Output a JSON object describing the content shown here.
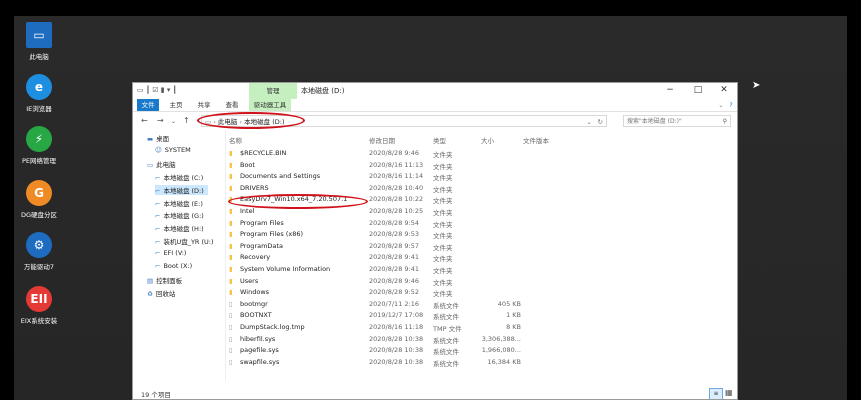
{
  "desktop": {
    "icons": [
      {
        "label": "此电脑",
        "icon": "computer-icon",
        "color": "#e8e8e8"
      },
      {
        "label": "IE浏览器",
        "icon": "ie-icon",
        "color": "#1e8fe0"
      },
      {
        "label": "PE网络管理",
        "icon": "network-icon",
        "color": "#28a745"
      },
      {
        "label": "DG硬盘分区",
        "icon": "diskgenius-icon",
        "color": "#f08a24"
      },
      {
        "label": "万能驱动7",
        "icon": "gear-icon",
        "color": "#1e6cbf"
      },
      {
        "label": "EIX系统安装",
        "icon": "eix-icon",
        "color": "#e53935"
      }
    ]
  },
  "window": {
    "title": "本地磁盘 (D:)",
    "context_tab": "管理",
    "ribbon_tabs": [
      "文件",
      "主页",
      "共享",
      "查看",
      "驱动器工具"
    ],
    "breadcrumb": [
      "此电脑",
      "本地磁盘 (D:)"
    ],
    "search_placeholder": "搜索\"本地磁盘 (D:)\"",
    "nav": [
      {
        "label": "桌面",
        "indent": 0,
        "icon": "folder-blue-icon"
      },
      {
        "label": "SYSTEM",
        "indent": 1,
        "icon": "user-icon"
      },
      {
        "label": "此电脑",
        "indent": 0,
        "icon": "computer-icon"
      },
      {
        "label": "本地磁盘 (C:)",
        "indent": 1,
        "icon": "drive-icon"
      },
      {
        "label": "本地磁盘 (D:)",
        "indent": 1,
        "icon": "drive-icon",
        "selected": true
      },
      {
        "label": "本地磁盘 (E:)",
        "indent": 1,
        "icon": "drive-icon"
      },
      {
        "label": "本地磁盘 (G:)",
        "indent": 1,
        "icon": "drive-icon"
      },
      {
        "label": "本地磁盘 (H:)",
        "indent": 1,
        "icon": "drive-icon"
      },
      {
        "label": "装机U盘_YR (U:)",
        "indent": 1,
        "icon": "drive-icon"
      },
      {
        "label": "EFI (V:)",
        "indent": 1,
        "icon": "drive-icon"
      },
      {
        "label": "Boot (X:)",
        "indent": 1,
        "icon": "drive-icon"
      },
      {
        "label": "控制面板",
        "indent": 0,
        "icon": "control-panel-icon"
      },
      {
        "label": "回收站",
        "indent": 0,
        "icon": "recycle-bin-icon"
      }
    ],
    "columns": [
      "名称",
      "修改日期",
      "类型",
      "大小",
      "文件版本"
    ],
    "files": [
      {
        "name": "$RECYCLE.BIN",
        "date": "2020/8/28 9:46",
        "type": "文件夹",
        "size": "",
        "kind": "folder"
      },
      {
        "name": "Boot",
        "date": "2020/8/16 11:13",
        "type": "文件夹",
        "size": "",
        "kind": "folder"
      },
      {
        "name": "Documents and Settings",
        "date": "2020/8/16 11:14",
        "type": "文件夹",
        "size": "",
        "kind": "folder"
      },
      {
        "name": "DRIVERS",
        "date": "2020/8/28 10:40",
        "type": "文件夹",
        "size": "",
        "kind": "folder"
      },
      {
        "name": "EasyDrv7_Win10.x64_7.20.507.1",
        "date": "2020/8/28 10:22",
        "type": "文件夹",
        "size": "",
        "kind": "folder"
      },
      {
        "name": "Intel",
        "date": "2020/8/28 10:25",
        "type": "文件夹",
        "size": "",
        "kind": "folder"
      },
      {
        "name": "Program Files",
        "date": "2020/8/28 9:54",
        "type": "文件夹",
        "size": "",
        "kind": "folder"
      },
      {
        "name": "Program Files (x86)",
        "date": "2020/8/28 9:53",
        "type": "文件夹",
        "size": "",
        "kind": "folder"
      },
      {
        "name": "ProgramData",
        "date": "2020/8/28 9:57",
        "type": "文件夹",
        "size": "",
        "kind": "folder"
      },
      {
        "name": "Recovery",
        "date": "2020/8/28 9:41",
        "type": "文件夹",
        "size": "",
        "kind": "folder"
      },
      {
        "name": "System Volume Information",
        "date": "2020/8/28 9:41",
        "type": "文件夹",
        "size": "",
        "kind": "folder"
      },
      {
        "name": "Users",
        "date": "2020/8/28 9:46",
        "type": "文件夹",
        "size": "",
        "kind": "folder"
      },
      {
        "name": "Windows",
        "date": "2020/8/28 9:52",
        "type": "文件夹",
        "size": "",
        "kind": "folder"
      },
      {
        "name": "bootmgr",
        "date": "2020/7/11 2:16",
        "type": "系统文件",
        "size": "405 KB",
        "kind": "file"
      },
      {
        "name": "BOOTNXT",
        "date": "2019/12/7 17:08",
        "type": "系统文件",
        "size": "1 KB",
        "kind": "file"
      },
      {
        "name": "DumpStack.log.tmp",
        "date": "2020/8/16 11:18",
        "type": "TMP 文件",
        "size": "8 KB",
        "kind": "file"
      },
      {
        "name": "hiberfil.sys",
        "date": "2020/8/28 10:38",
        "type": "系统文件",
        "size": "3,306,388...",
        "kind": "file"
      },
      {
        "name": "pagefile.sys",
        "date": "2020/8/28 10:38",
        "type": "系统文件",
        "size": "1,966,080...",
        "kind": "file"
      },
      {
        "name": "swapfile.sys",
        "date": "2020/8/28 10:38",
        "type": "系统文件",
        "size": "16,384 KB",
        "kind": "file"
      }
    ],
    "status": "19 个项目"
  },
  "colors": {
    "highlight": "#d0121b",
    "ribbon_file": "#1979ca",
    "context": "#c6efc0",
    "folder": "#f5c542"
  }
}
